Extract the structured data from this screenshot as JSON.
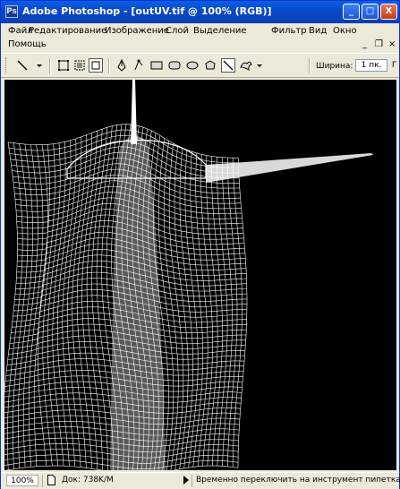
{
  "window": {
    "title": "Adobe Photoshop - [outUV.tif @ 100% (RGB)]",
    "app_icon_text": "Ps",
    "controls": {
      "minimize": "_",
      "maximize": "□",
      "close": "X"
    }
  },
  "menu": {
    "items": [
      "Файл",
      "Редактирование",
      "Изображение",
      "Слой",
      "Выделение",
      "Фильтр",
      "Вид",
      "Окно",
      "Помощь"
    ],
    "mdi_controls": {
      "minimize": "_",
      "restore": "❐",
      "close": "×"
    }
  },
  "toolbar": {
    "weight_label": "Ширина:",
    "weight_value": "1 пк.",
    "end_glyph": "Г"
  },
  "status": {
    "zoom": "100%",
    "doc_info": "Док: 738K/M",
    "message": "Временно переключить на инструмент пипетка"
  },
  "colors": {
    "title_bar": "#0848c8",
    "canvas_background": "#000000",
    "mesh": "#ffffff"
  }
}
